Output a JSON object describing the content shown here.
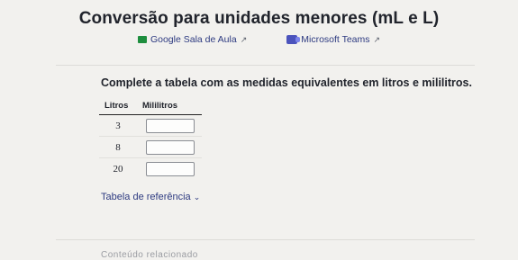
{
  "page": {
    "title": "Conversão para unidades menores (mL e L)",
    "share": [
      {
        "label": "Google Sala de Aula",
        "icon": "google-classroom-icon"
      },
      {
        "label": "Microsoft Teams",
        "icon": "microsoft-teams-icon"
      }
    ],
    "prompt": "Complete a tabela com as medidas equivalentes em litros e mililitros.",
    "table": {
      "headers": [
        "Litros",
        "Mililitros"
      ],
      "rows": [
        {
          "liters": "3",
          "ml": ""
        },
        {
          "liters": "8",
          "ml": ""
        },
        {
          "liters": "20",
          "ml": ""
        }
      ]
    },
    "reference_label": "Tabela de referência",
    "related_label": "Conteúdo relacionado"
  },
  "colors": {
    "link": "#2d3a80",
    "background": "#f2f1ee"
  }
}
